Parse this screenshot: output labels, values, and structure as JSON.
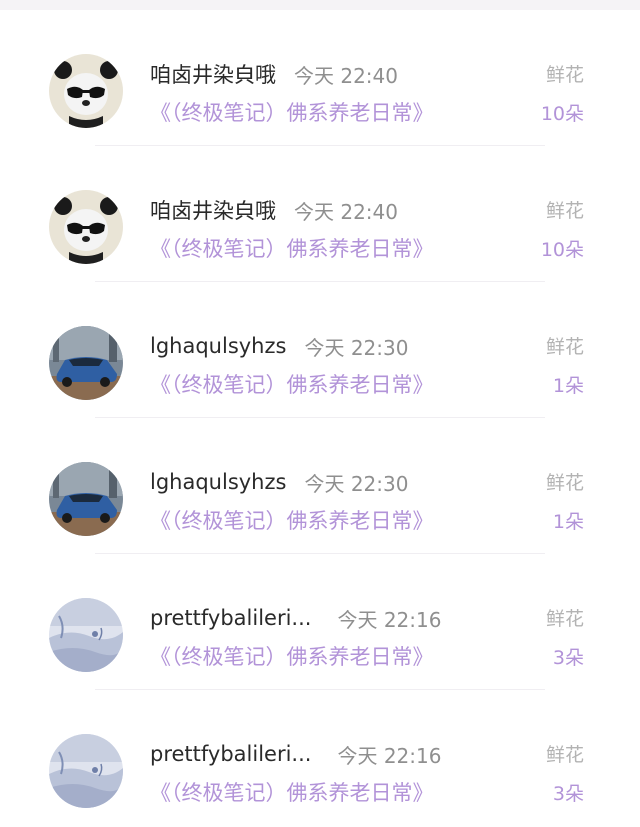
{
  "rows": [
    {
      "username": "咱卤井染㒵哦",
      "time": "今天 22:40",
      "book": "《（终极笔记）佛系养老日常》",
      "gift_label": "鲜花",
      "gift_count": "10朵",
      "avatar_icon": "panda-avatar-icon"
    },
    {
      "username": "咱卤井染㒵哦",
      "time": "今天 22:40",
      "book": "《（终极笔记）佛系养老日常》",
      "gift_label": "鲜花",
      "gift_count": "10朵",
      "avatar_icon": "panda-avatar-icon"
    },
    {
      "username": "lghaqulsyhzs",
      "time": "今天 22:30",
      "book": "《（终极笔记）佛系养老日常》",
      "gift_label": "鲜花",
      "gift_count": "1朵",
      "avatar_icon": "car-avatar-icon"
    },
    {
      "username": "lghaqulsyhzs",
      "time": "今天 22:30",
      "book": "《（终极笔记）佛系养老日常》",
      "gift_label": "鲜花",
      "gift_count": "1朵",
      "avatar_icon": "car-avatar-icon"
    },
    {
      "username": "prettfybalileri...",
      "time": "今天 22:16",
      "book": "《（终极笔记）佛系养老日常》",
      "gift_label": "鲜花",
      "gift_count": "3朵",
      "avatar_icon": "landscape-avatar-icon"
    },
    {
      "username": "prettfybalileri...",
      "time": "今天 22:16",
      "book": "《（终极笔记）佛系养老日常》",
      "gift_label": "鲜花",
      "gift_count": "3朵",
      "avatar_icon": "landscape-avatar-icon"
    }
  ],
  "colors": {
    "accent_purple": "#b293d8",
    "muted_gray": "#8f8f8f",
    "label_gray": "#b3b3b3",
    "text_dark": "#2a2a2a"
  }
}
